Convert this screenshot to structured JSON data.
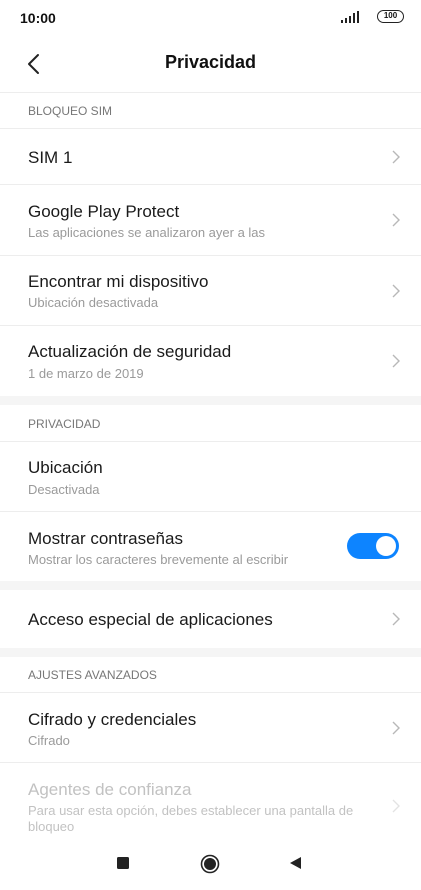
{
  "status_bar": {
    "time": "10:00",
    "battery": "100",
    "icons": [
      "signal-icon",
      "battery-icon"
    ]
  },
  "header": {
    "title": "Privacidad",
    "back_icon": "chevron-left-icon"
  },
  "sections": {
    "sim_lock": "BLOQUEO SIM",
    "privacy": "PRIVACIDAD",
    "advanced": "AJUSTES AVANZADOS"
  },
  "items": {
    "sim1": {
      "title": "SIM 1"
    },
    "play_protect": {
      "title": "Google Play Protect",
      "subtitle": "Las aplicaciones se analizaron ayer a las"
    },
    "find_device": {
      "title": "Encontrar mi dispositivo",
      "subtitle": "Ubicación desactivada"
    },
    "security_update": {
      "title": "Actualización de seguridad",
      "subtitle": "1 de marzo de 2019"
    },
    "location": {
      "title": "Ubicación",
      "subtitle": "Desactivada"
    },
    "show_passwords": {
      "title": "Mostrar contraseñas",
      "subtitle": "Mostrar los caracteres brevemente al escribir",
      "toggle_on": true
    },
    "special_access": {
      "title": "Acceso especial de aplicaciones"
    },
    "encryption": {
      "title": "Cifrado y credenciales",
      "subtitle": "Cifrado"
    },
    "trust_agents": {
      "title": "Agentes de confianza",
      "subtitle": "Para usar esta opción, debes establecer una pantalla de bloqueo",
      "enabled": false
    }
  },
  "nav_bar": {
    "icons": [
      "recents-icon",
      "home-icon",
      "back-icon"
    ]
  },
  "colors": {
    "accent": "#0d84ff",
    "section_gap": "#f5f5f5",
    "secondary_text": "#9a9a9a",
    "disabled_text": "#c2c2c2"
  }
}
